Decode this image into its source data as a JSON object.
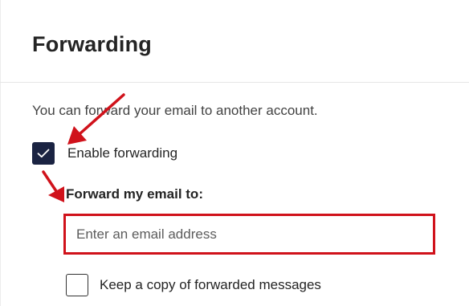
{
  "section": {
    "title": "Forwarding",
    "description": "You can forward your email to another account."
  },
  "enable_forwarding": {
    "label": "Enable forwarding",
    "checked": true
  },
  "forward_to": {
    "label": "Forward my email to:",
    "placeholder": "Enter an email address",
    "value": ""
  },
  "keep_copy": {
    "label": "Keep a copy of forwarded messages",
    "checked": false
  },
  "colors": {
    "checkbox_checked": "#1a2342",
    "annotation_red": "#d0121b",
    "text": "#242424",
    "divider": "#e6e6e6"
  },
  "icons": {
    "check": "checkmark-icon",
    "annotation_arrow": "red-arrow-icon"
  }
}
